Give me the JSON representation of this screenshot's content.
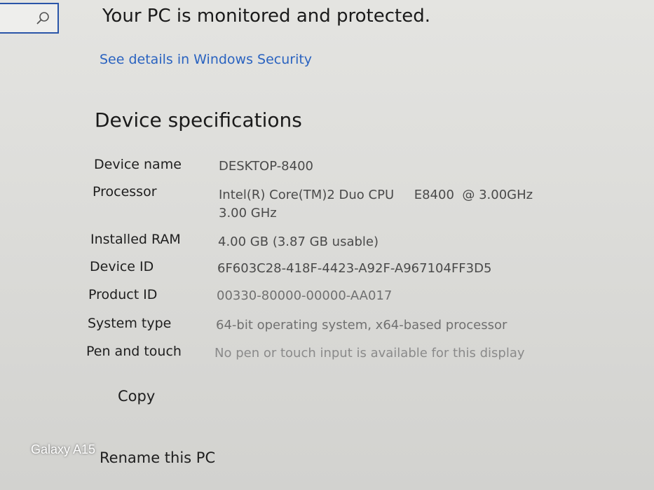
{
  "security": {
    "title": "Your PC is monitored and protected.",
    "link": "See details in Windows Security"
  },
  "specs": {
    "title": "Device specifications",
    "rows": [
      {
        "label": "Device name",
        "value": "DESKTOP-8400"
      },
      {
        "label": "Processor",
        "value": "Intel(R) Core(TM)2 Duo CPU     E8400  @ 3.00GHz",
        "value2": "3.00 GHz"
      },
      {
        "label": "Installed RAM",
        "value": "4.00 GB (3.87 GB usable)"
      },
      {
        "label": "Device ID",
        "value": "6F603C28-418F-4423-A92F-A967104FF3D5"
      },
      {
        "label": "Product ID",
        "value": "00330-80000-00000-AA017"
      },
      {
        "label": "System type",
        "value": "64-bit operating system, x64-based processor"
      },
      {
        "label": "Pen and touch",
        "value": "No pen or touch input is available for this display"
      }
    ],
    "copy_label": "Copy"
  },
  "rename_label": "Rename this PC",
  "watermark": "Galaxy A15",
  "colors": {
    "link": "#2a63c0",
    "search_border": "#2a55a8"
  },
  "icons": {
    "search": "search-icon"
  }
}
